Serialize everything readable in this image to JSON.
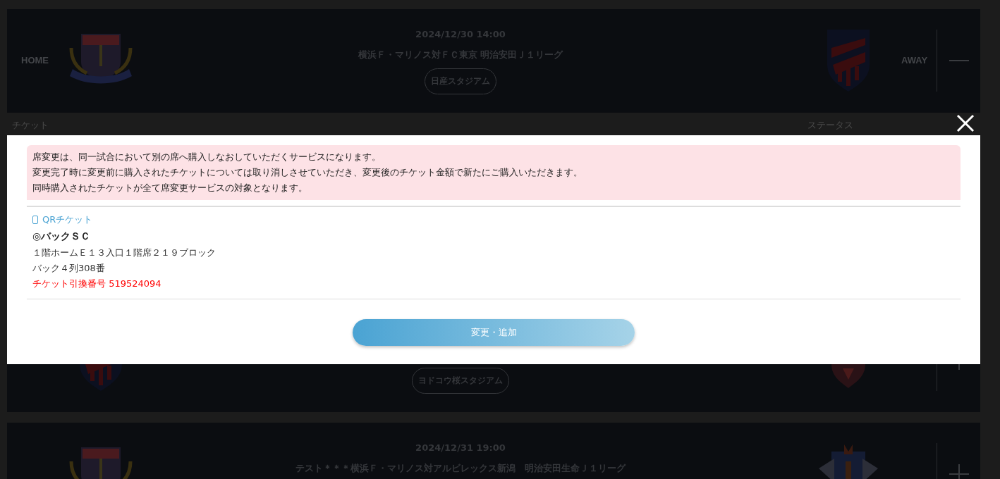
{
  "matches": [
    {
      "home_label": "HOME",
      "date": "2024/12/30 14:00",
      "title": "横浜Ｆ・マリノス対ＦＣ東京 明治安田Ｊ１リーグ",
      "stadium": "日産スタジアム",
      "away_label": "AWAY",
      "expanded": true
    },
    {
      "stadium": "ヨドコウ桜スタジアム",
      "expanded": false
    },
    {
      "date": "2024/12/31 19:00",
      "title": "テスト＊＊＊横浜Ｆ・マリノス対アルビレックス新潟　明治安田生命Ｊ１リーグ",
      "expanded": false
    }
  ],
  "columns": [
    "チケット",
    "ステータス"
  ],
  "modal": {
    "notice": [
      "席変更は、同一試合において別の席へ購入しなおしていただくサービスになります。",
      "変更完了時に変更前に購入されたチケットについては取り消しさせていただき、変更後のチケット金額で新たにご購入いただきます。",
      "同時購入されたチケットが全て席変更サービスの対象となります。"
    ],
    "ticket_type": "QRチケット",
    "seat_type": "◎バックＳＣ",
    "seat_location": "１階ホームＥ１３入口１階席２１９ブロック",
    "seat_row": "バック４列308番",
    "exchange_number": "チケット引換番号 519524094",
    "button": "変更・追加"
  }
}
